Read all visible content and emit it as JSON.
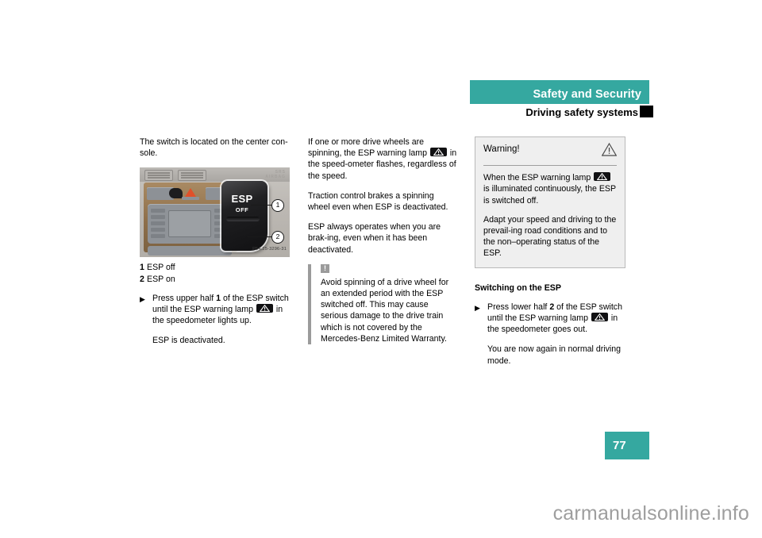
{
  "header": {
    "band_title": "Safety and Security",
    "section_title": "Driving safety systems"
  },
  "left_column": {
    "intro": "The switch is located on the center con-sole.",
    "figure": {
      "esp_label": "ESP",
      "off_label": "OFF",
      "callout_1": "1",
      "callout_2": "2",
      "srs_line1": "SRS",
      "srs_line2": "AIRBAG",
      "image_code": "P54.25-3296-31"
    },
    "legend": [
      {
        "num": "1",
        "text": "ESP off"
      },
      {
        "num": "2",
        "text": "ESP on"
      }
    ],
    "step": {
      "arrow": "▶",
      "text_before": "Press upper half ",
      "bold_num": "1",
      "text_after": " of the ESP switch until the ESP warning lamp ",
      "text_tail": " in the speedometer lights up.",
      "result": "ESP is deactivated."
    }
  },
  "middle_column": {
    "para1_before": "If one or more drive wheels are spinning, the ESP warning lamp ",
    "para1_after": " in the speed-ometer flashes, regardless of the speed.",
    "para2": "Traction control brakes a spinning wheel even when ESP is deactivated.",
    "para3": "ESP always operates when you are brak-ing, even when it has been deactivated.",
    "notice": {
      "icon": "exclamation-icon",
      "text": "Avoid spinning of a drive wheel for an extended period with the ESP switched off. This may cause serious damage to the drive train which is not covered by the Mercedes-Benz Limited Warranty."
    }
  },
  "right_column": {
    "warning_box": {
      "title": "Warning!",
      "icon": "warning-triangle-icon",
      "para1_before": "When the ESP warning lamp ",
      "para1_after": " is illuminated continuously, the ESP is switched off.",
      "para2": "Adapt your speed and driving to the prevail-ing road conditions and to the non–operating status of the ESP."
    },
    "subheading": "Switching on the ESP",
    "step": {
      "arrow": "▶",
      "text_before": "Press lower half ",
      "bold_num": "2",
      "text_after": " of the ESP switch until the ESP warning lamp ",
      "text_tail": " in the speedometer goes out.",
      "result": "You are now again in normal driving mode."
    }
  },
  "page": {
    "number": "77"
  },
  "watermark": {
    "text": "carmanualsonline.info"
  },
  "colors": {
    "teal": "#35a8a0",
    "notice_gray": "#9b9b9b",
    "warnbox_bg": "#efefef"
  }
}
